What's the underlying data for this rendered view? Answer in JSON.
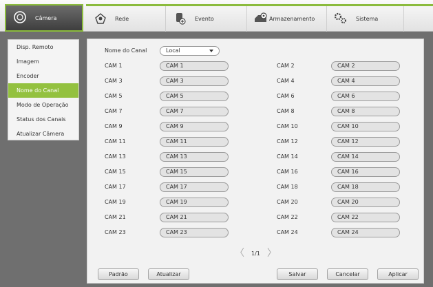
{
  "tabs": [
    {
      "label": "Câmera",
      "icon": "camera-icon",
      "active": true
    },
    {
      "label": "Rede",
      "icon": "network-icon",
      "active": false
    },
    {
      "label": "Evento",
      "icon": "event-icon",
      "active": false
    },
    {
      "label": "Armazenamento",
      "icon": "storage-icon",
      "active": false
    },
    {
      "label": "Sistema",
      "icon": "system-icon",
      "active": false
    }
  ],
  "sidebar": {
    "items": [
      {
        "label": "Disp. Remoto"
      },
      {
        "label": "Imagem"
      },
      {
        "label": "Encoder"
      },
      {
        "label": "Nome do Canal",
        "active": true
      },
      {
        "label": "Modo de Operação"
      },
      {
        "label": "Status dos Canais"
      },
      {
        "label": "Atualizar Câmera"
      }
    ]
  },
  "main": {
    "channel_name_label": "Nome do Canal",
    "channel_select_value": "Local",
    "channels": [
      {
        "label": "CAM 1",
        "value": "CAM 1"
      },
      {
        "label": "CAM 2",
        "value": "CAM 2"
      },
      {
        "label": "CAM 3",
        "value": "CAM 3"
      },
      {
        "label": "CAM 4",
        "value": "CAM 4"
      },
      {
        "label": "CAM 5",
        "value": "CAM 5"
      },
      {
        "label": "CAM 6",
        "value": "CAM 6"
      },
      {
        "label": "CAM 7",
        "value": "CAM 7"
      },
      {
        "label": "CAM 8",
        "value": "CAM 8"
      },
      {
        "label": "CAM 9",
        "value": "CAM 9"
      },
      {
        "label": "CAM 10",
        "value": "CAM 10"
      },
      {
        "label": "CAM 11",
        "value": "CAM 11"
      },
      {
        "label": "CAM 12",
        "value": "CAM 12"
      },
      {
        "label": "CAM 13",
        "value": "CAM 13"
      },
      {
        "label": "CAM 14",
        "value": "CAM 14"
      },
      {
        "label": "CAM 15",
        "value": "CAM 15"
      },
      {
        "label": "CAM 16",
        "value": "CAM 16"
      },
      {
        "label": "CAM 17",
        "value": "CAM 17"
      },
      {
        "label": "CAM 18",
        "value": "CAM 18"
      },
      {
        "label": "CAM 19",
        "value": "CAM 19"
      },
      {
        "label": "CAM 20",
        "value": "CAM 20"
      },
      {
        "label": "CAM 21",
        "value": "CAM 21"
      },
      {
        "label": "CAM 22",
        "value": "CAM 22"
      },
      {
        "label": "CAM 23",
        "value": "CAM 23"
      },
      {
        "label": "CAM 24",
        "value": "CAM 24"
      }
    ],
    "pager": "1/1",
    "buttons": {
      "default": "Padrão",
      "refresh": "Atualizar",
      "save": "Salvar",
      "cancel": "Cancelar",
      "apply": "Aplicar"
    }
  },
  "colors": {
    "accent": "#93c13f",
    "background": "#6f6f6f"
  }
}
